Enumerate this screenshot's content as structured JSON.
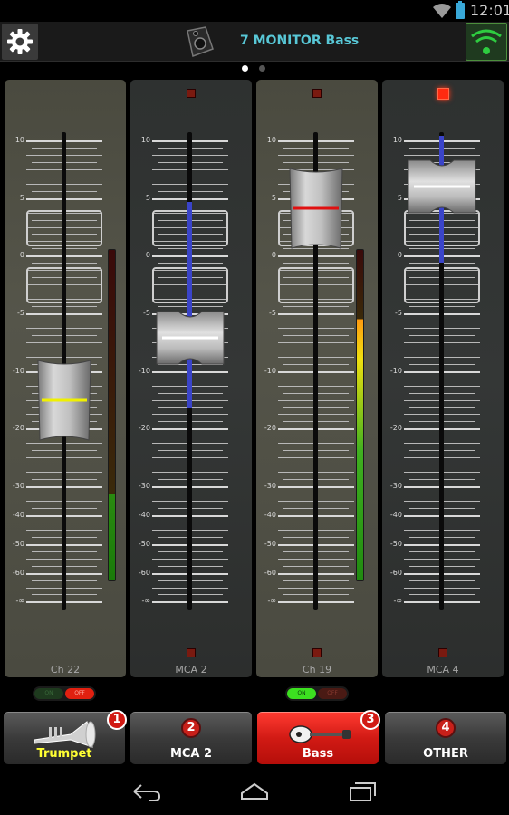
{
  "status_bar": {
    "time": "12:01"
  },
  "header": {
    "title": "7  MONITOR Bass"
  },
  "pager": {
    "dot_count": 2,
    "active_index": 0
  },
  "scale_labels": [
    "10",
    "5",
    "0",
    "-5",
    "-10",
    "-20",
    "-30",
    "-40",
    "-50",
    "-60",
    "-∞"
  ],
  "channels": [
    {
      "label": "Ch 22",
      "fader_level_db": -15,
      "cap_line_color": "#f0f000",
      "meter_level": 0.26,
      "mute_led": "none",
      "switch": "off"
    },
    {
      "label": "MCA 2",
      "fader_level_db": -6,
      "cap_line_color": "#ffffff",
      "meter_level": 0,
      "mute_led": "dim",
      "switch": "none"
    },
    {
      "label": "Ch 19",
      "fader_level_db": 3,
      "cap_line_color": "#e01010",
      "meter_level": 0.79,
      "mute_led": "dim",
      "switch": "on"
    },
    {
      "label": "MCA 4",
      "fader_level_db": 6,
      "cap_line_color": "#ffffff",
      "meter_level": 0,
      "mute_led": "lit",
      "switch": "none"
    }
  ],
  "switches": {
    "on_label": "ON",
    "off_label": "OFF"
  },
  "tabs": [
    {
      "number": "1",
      "label": "Trumpet",
      "icon": "trumpet-icon",
      "selected": false,
      "label_color": "#ffff33"
    },
    {
      "number": "2",
      "label": "MCA 2",
      "icon": "",
      "selected": false,
      "label_color": "#ffffff"
    },
    {
      "number": "3",
      "label": "Bass",
      "icon": "bass-guitar-icon",
      "selected": true,
      "label_color": "#ffffff"
    },
    {
      "number": "4",
      "label": "OTHER",
      "icon": "",
      "selected": false,
      "label_color": "#ffffff"
    }
  ],
  "colors": {
    "accent": "#58c7d6",
    "selected_tab": "#d11a14",
    "wifi_green": "#2ecc40"
  }
}
